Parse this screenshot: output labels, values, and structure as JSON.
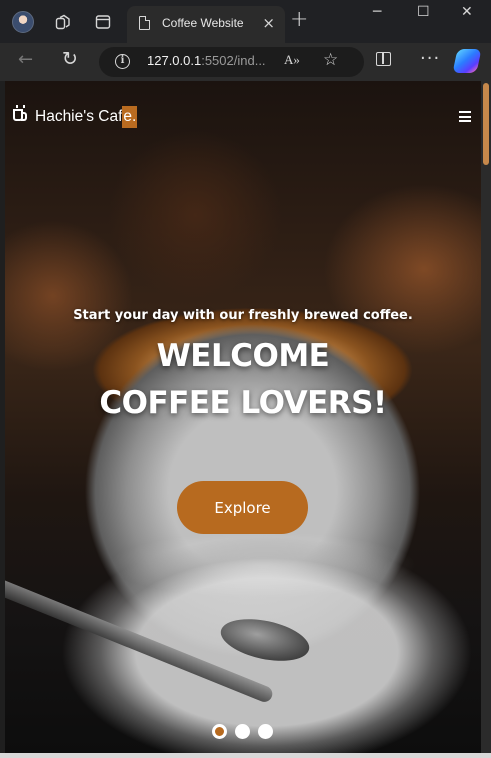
{
  "browser": {
    "tab_title": "Coffee Website",
    "tab_close": "×",
    "new_tab": "+",
    "window_minimize": "─",
    "window_maximize": "☐",
    "window_close": "✕",
    "url_host": "127.0.0.1",
    "url_rest": ":5502/ind...",
    "read_aloud": "A»",
    "icons": [
      "profile-avatar-icon",
      "workspaces-icon",
      "tab-actions-icon",
      "page-icon",
      "back-arrow-icon",
      "reload-icon",
      "site-info-icon",
      "favorite-star-icon",
      "split-screen-icon",
      "more-icon",
      "copilot-icon"
    ]
  },
  "nav": {
    "brand_main": "Hachie's Caf",
    "brand_highlight": "e.",
    "menu_icon": "hamburger-menu-icon"
  },
  "hero": {
    "subtitle": "Start your day with our freshly brewed coffee.",
    "title_line1": "WELCOME",
    "title_line2": "COFFEE LOVERS!",
    "cta_label": "Explore"
  },
  "slider": {
    "count": 3,
    "active_index": 0
  },
  "colors": {
    "accent": "#b76a1f",
    "chrome_bg": "#202124",
    "toolbar_bg": "#2b2b2b"
  }
}
